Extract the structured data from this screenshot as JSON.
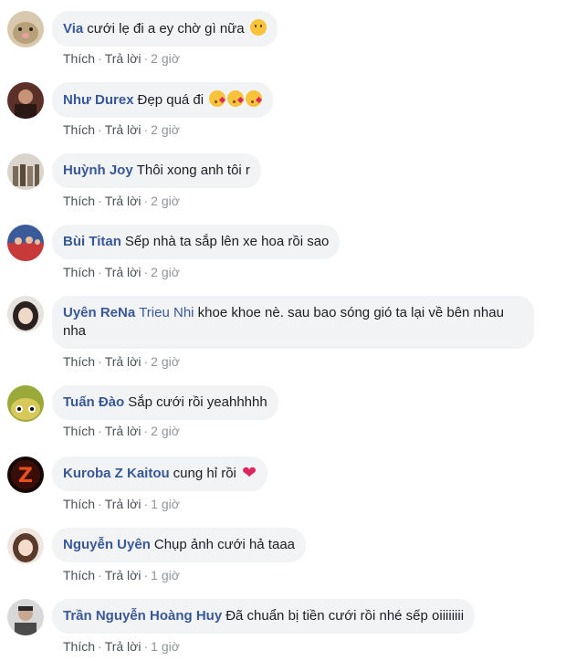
{
  "action_labels": {
    "like": "Thích",
    "reply": "Trả lời",
    "separator": "·"
  },
  "comments": [
    {
      "author": "Via",
      "mention": "",
      "text": "cưới lẹ đi a ey chờ gì nữa",
      "emoji": "sad-face",
      "time": "2 giờ",
      "avatar_color": "#c9b59a"
    },
    {
      "author": "Như Durex",
      "mention": "",
      "text": "Đẹp quá đi",
      "emoji": "kissing-face x3",
      "time": "2 giờ",
      "avatar_color": "#7a4a3a"
    },
    {
      "author": "Huỳnh Joy",
      "mention": "",
      "text": "Thôi xong anh tôi r",
      "emoji": "",
      "time": "2 giờ",
      "avatar_color": "#a9a39a"
    },
    {
      "author": "Bùi Titan",
      "mention": "",
      "text": "Sếp nhà ta sắp lên xe hoa rồi sao",
      "emoji": "",
      "time": "2 giờ",
      "avatar_color": "#b5333a"
    },
    {
      "author": "Uyên ReNa",
      "mention": "Trieu Nhi",
      "text": "khoe khoe nè. sau bao sóng gió ta lại về bên nhau nha",
      "emoji": "",
      "time": "2 giờ",
      "avatar_color": "#3a3230"
    },
    {
      "author": "Tuấn Đào",
      "mention": "",
      "text": "Sắp cưới rồi yeahhhhh",
      "emoji": "",
      "time": "2 giờ",
      "avatar_color": "#b6c24a"
    },
    {
      "author": "Kuroba Z Kaitou",
      "mention": "",
      "text": "cung hỉ rồi",
      "emoji": "heart",
      "time": "1 giờ",
      "avatar_color": "#1a0a08"
    },
    {
      "author": "Nguyễn Uyên",
      "mention": "",
      "text": "Chụp ảnh cưới hả taaa",
      "emoji": "",
      "time": "1 giờ",
      "avatar_color": "#d9c2b4"
    },
    {
      "author": "Trần Nguyễn Hoàng Huy",
      "mention": "",
      "text": "Đã chuẩn bị tiền cưới rồi nhé sếp oiiiiiiii",
      "emoji": "",
      "time": "1 giờ",
      "avatar_color": "#c8c8c8"
    }
  ]
}
